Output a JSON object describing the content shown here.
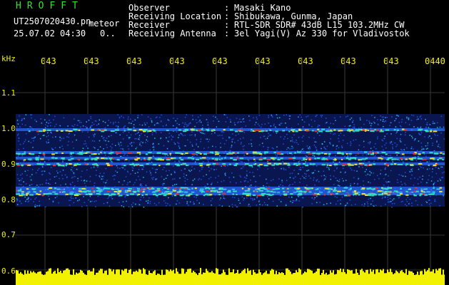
{
  "header": {
    "title": "HROFFT",
    "filename": "UT2507020430.pn",
    "meteor_label": "meteor",
    "datetime": "25.07.02 04:30",
    "count": "0.."
  },
  "info": [
    {
      "label": "Observer",
      "value": "Masaki Kano"
    },
    {
      "label": "Receiving Location",
      "value": "Shibukawa, Gunma, Japan"
    },
    {
      "label": "Receiver",
      "value": "RTL-SDR SDR# 43dB L15 103.2MHz CW"
    },
    {
      "label": "Receiving Antenna",
      "value": "3el Yagi(V) Az 330 for Vladivostok"
    }
  ],
  "axis": {
    "unit": "kHz",
    "y_ticks": [
      "1.1",
      "1.0",
      "0.9",
      "0.8",
      "0.7",
      "0.6"
    ],
    "time_ticks": [
      "043",
      "043",
      "043",
      "043",
      "043",
      "043",
      "043",
      "043",
      "043",
      "0440"
    ]
  },
  "colors": {
    "background": "#000000",
    "header_green": "#2ee62e",
    "accent_yellow": "#f2f200",
    "spectrum_blue": "#1a3cc8",
    "signal_red": "#e63030"
  }
}
